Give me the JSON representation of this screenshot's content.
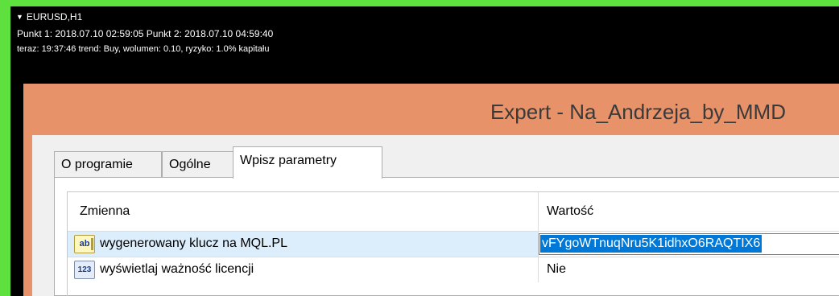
{
  "chart_overlay": {
    "symbol": "EURUSD,H1",
    "points_line": "Punkt 1: 2018.07.10 02:59:05  Punkt 2: 2018.07.10 04:59:40",
    "status_line": "teraz: 19:37:46  trend: Buy,  wolumen: 0.10, ryzyko: 1.0% kapitału"
  },
  "dialog": {
    "title": "Expert - Na_Andrzeja_by_MMD",
    "tabs": [
      {
        "label": "O programie",
        "active": false
      },
      {
        "label": "Ogólne",
        "active": false
      },
      {
        "label": "Wpisz parametry",
        "active": true
      }
    ],
    "grid": {
      "columns": [
        "Zmienna",
        "Wartość"
      ],
      "rows": [
        {
          "icon": "string-type-icon",
          "icon_glyph": "ab",
          "name": "wygenerowany klucz na MQL.PL",
          "value": "vFYgoWTnuqNru5K1idhxO6RAQTIX6",
          "selected": true
        },
        {
          "icon": "number-type-icon",
          "icon_glyph": "123",
          "name": "wyświetlaj ważność licencji",
          "value": "Nie",
          "selected": false
        }
      ]
    }
  },
  "colors": {
    "outer_background": "#5ee03f",
    "chart_background": "#000000",
    "dialog_frame": "#e8926a",
    "selection": "#0078d7"
  }
}
